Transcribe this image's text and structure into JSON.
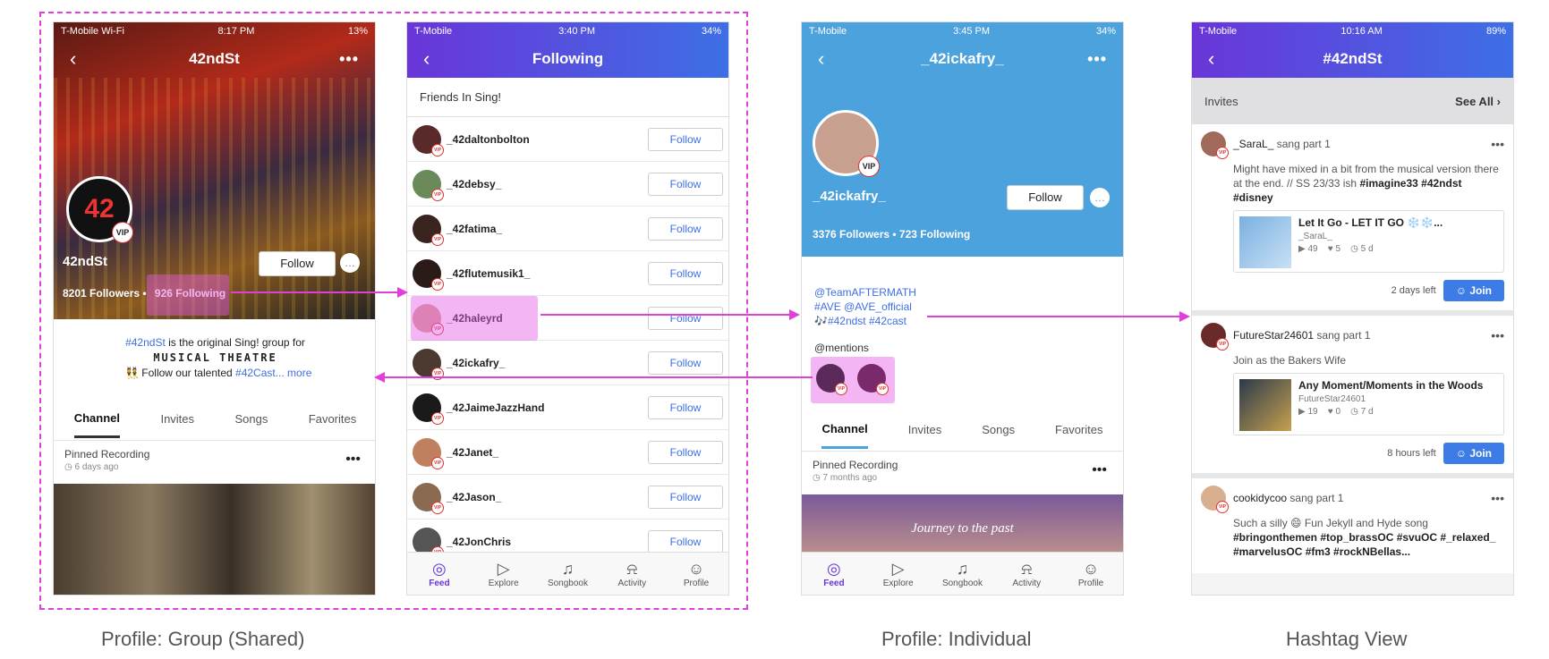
{
  "phone1": {
    "status": {
      "carrier": "T-Mobile Wi-Fi",
      "time": "8:17 PM",
      "battery": "13%"
    },
    "title": "42ndSt",
    "name": "42ndSt",
    "vip": "VIP",
    "follow_label": "Follow",
    "followers": "8201 Followers",
    "following": "926 Following",
    "bio_hashtag": "#42ndSt",
    "bio_text": "is the original Sing! group for",
    "bio_line2": "MUSICAL THEATRE",
    "bio_line3a": "Follow our talented",
    "bio_line3b": "#42Cast",
    "more": "... more",
    "tabs": [
      "Channel",
      "Invites",
      "Songs",
      "Favorites"
    ],
    "pinned": "Pinned Recording",
    "pinned_time": "6 days ago"
  },
  "phone2": {
    "status": {
      "carrier": "T-Mobile",
      "time": "3:40 PM",
      "battery": "34%"
    },
    "title": "Following",
    "section": "Friends In Sing!",
    "follow_label": "Follow",
    "users": [
      "_42daltonbolton",
      "_42debsy_",
      "_42fatima_",
      "_42flutemusik1_",
      "_42haleyrd",
      "_42ickafry_",
      "_42JaimeJazzHand",
      "_42Janet_",
      "_42Jason_",
      "_42JonChris"
    ]
  },
  "phone3": {
    "status": {
      "carrier": "T-Mobile",
      "time": "3:45 PM",
      "battery": "34%"
    },
    "title": "_42ickafry_",
    "name": "_42ickafry_",
    "vip": "VIP",
    "follow_label": "Follow",
    "followers": "3376 Followers",
    "following": "723 Following",
    "bio1": "@TeamAFTERMATH",
    "bio2": "#AVE @AVE_official",
    "bio3": "🎶#42ndst #42cast",
    "mentions": "@mentions",
    "tabs": [
      "Channel",
      "Invites",
      "Songs",
      "Favorites"
    ],
    "pinned": "Pinned Recording",
    "pinned_time": "7 months ago",
    "banner_text": "Journey to the past"
  },
  "phone4": {
    "status": {
      "carrier": "T-Mobile",
      "time": "10:16 AM",
      "battery": "89%"
    },
    "title": "#42ndSt",
    "invites": "Invites",
    "see_all": "See All",
    "cards": [
      {
        "user": "_SaraL_",
        "action": "sang part 1",
        "text": "Might have mixed in a bit from the musical version there at the end. // SS 23/33 ish",
        "tags": "#imagine33 #42ndst #disney",
        "song": "Let It Go - LET IT GO ❄️❄️...",
        "artist": "_SaraL_",
        "plays": "49",
        "likes": "5",
        "age": "5 d",
        "left": "2 days left",
        "join": "Join"
      },
      {
        "user": "FutureStar24601",
        "action": "sang part 1",
        "text": "Join as the Bakers Wife",
        "tags": "",
        "song": "Any Moment/Moments in the Woods",
        "artist": "FutureStar24601",
        "plays": "19",
        "likes": "0",
        "age": "7 d",
        "left": "8 hours left",
        "join": "Join"
      },
      {
        "user": "cookidycoo",
        "action": "sang part 1",
        "text": "Such a silly 😄 Fun Jekyll and Hyde song",
        "tags": "#bringonthemen #top_brassOC #svuOC #_relaxed_ #marvelusOC #fm3 #rockNBellas..."
      }
    ]
  },
  "bottom_nav": [
    "Feed",
    "Explore",
    "Songbook",
    "Activity",
    "Profile"
  ],
  "captions": [
    "Profile: Group (Shared)",
    "Profile: Individual",
    "Hashtag View"
  ]
}
